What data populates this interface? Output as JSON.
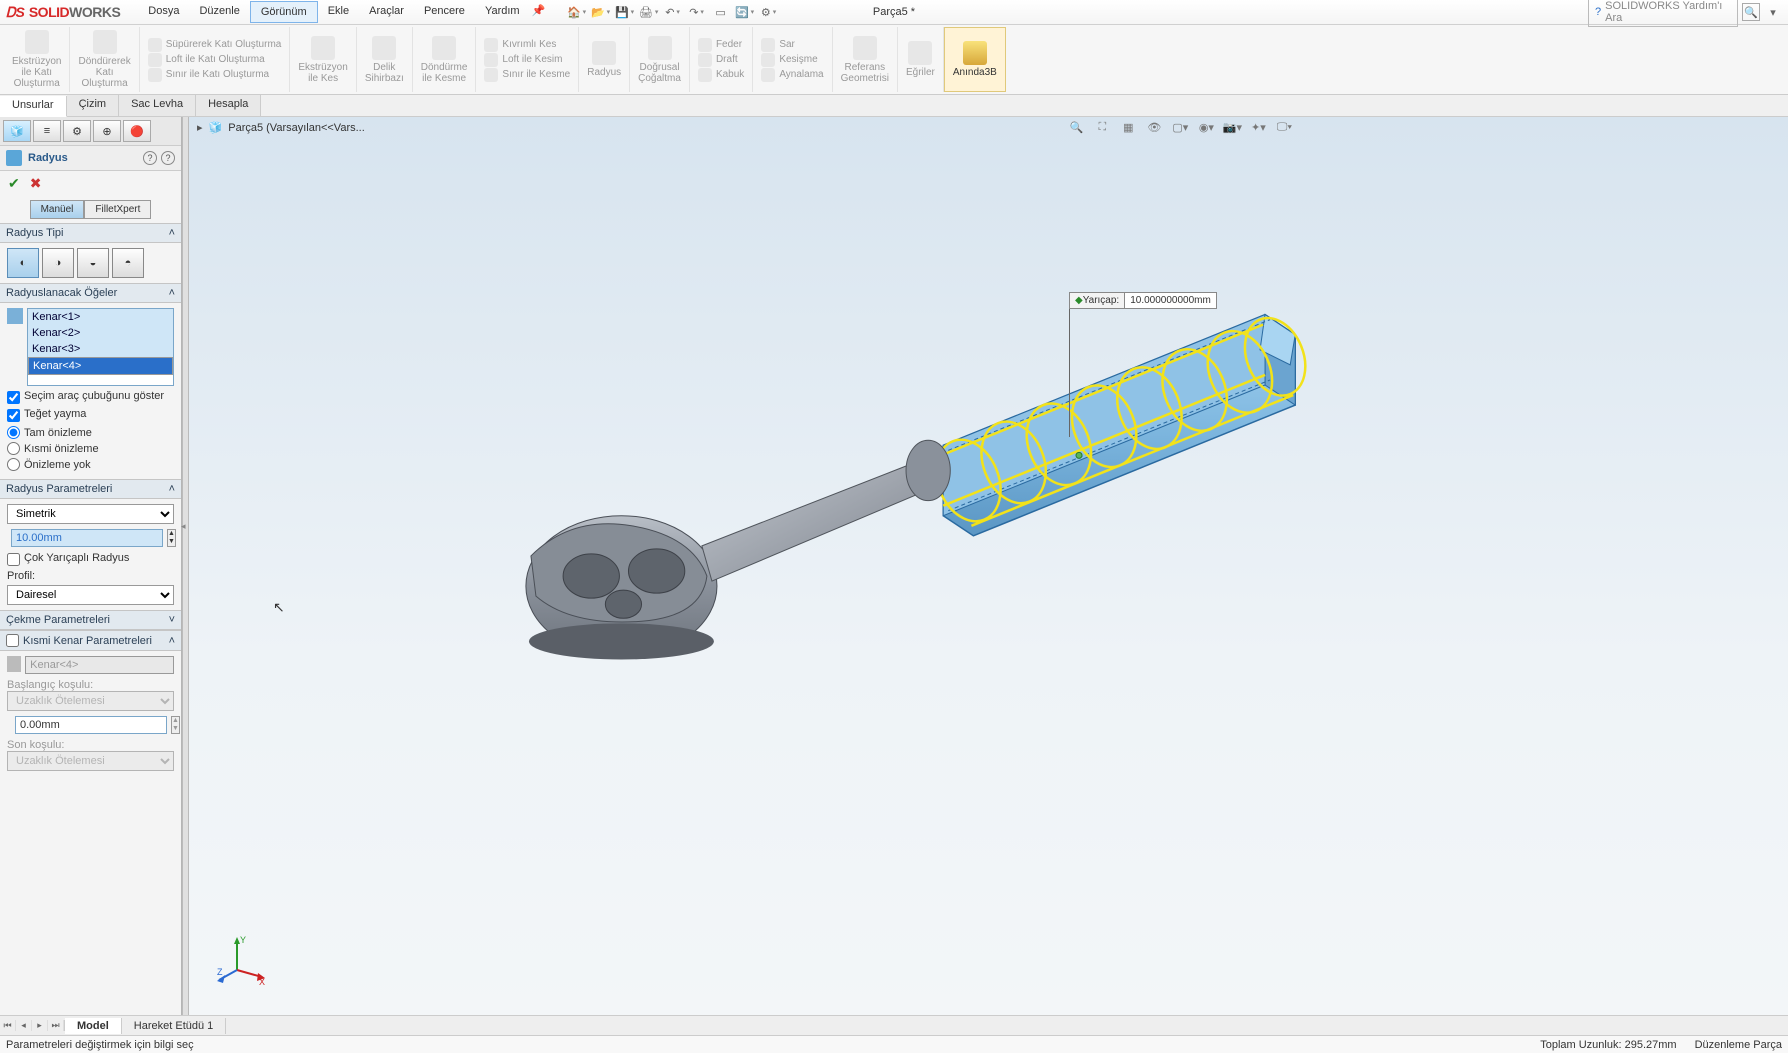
{
  "app": {
    "name_solid": "SOLID",
    "name_works": "WORKS",
    "ds": "DS"
  },
  "menus": [
    "Dosya",
    "Düzenle",
    "Görünüm",
    "Ekle",
    "Araçlar",
    "Pencere",
    "Yardım"
  ],
  "menu_active_index": 2,
  "doc_title": "Parça5 *",
  "search_placeholder": "SOLIDWORKS Yardım'ı Ara",
  "ribbon": {
    "g1": {
      "l1": "Ekstrüzyon",
      "l2": "ile Katı",
      "l3": "Oluşturma"
    },
    "g2": {
      "l1": "Döndürerek",
      "l2": "Katı",
      "l3": "Oluşturma"
    },
    "g3a": "Süpürerek Katı Oluşturma",
    "g3b": "Loft ile Katı Oluşturma",
    "g3c": "Sınır ile Katı Oluşturma",
    "g4": {
      "l1": "Ekstrüzyon",
      "l2": "ile Kes"
    },
    "g5": {
      "l1": "Delik",
      "l2": "Sihirbazı"
    },
    "g6": {
      "l1": "Döndürme",
      "l2": "ile Kesme"
    },
    "g7a": "Kıvrımlı Kes",
    "g7b": "Loft ile Kesim",
    "g7c": "Sınır ile Kesme",
    "g8": "Radyus",
    "g9": {
      "l1": "Doğrusal",
      "l2": "Çoğaltma"
    },
    "g10a": "Feder",
    "g10b": "Draft",
    "g10c": "Kabuk",
    "g11a": "Sar",
    "g11b": "Kesişme",
    "g11c": "Aynalama",
    "g12": {
      "l1": "Referans",
      "l2": "Geometrisi"
    },
    "g13": "Eğriler",
    "g14": "Anında3B"
  },
  "ftabs": [
    "Unsurlar",
    "Çizim",
    "Sac Levha",
    "Hesapla"
  ],
  "ftab_active": 0,
  "crumb": "Parça5  (Varsayılan<<Vars...",
  "pm": {
    "title": "Radyus",
    "mode_tabs": [
      "Manüel",
      "FilletXpert"
    ],
    "mode_active": 0,
    "sec_type": "Radyus Tipi",
    "sec_items": "Radyuslanacak Öğeler",
    "edges": [
      "Kenar<1>",
      "Kenar<2>",
      "Kenar<3>",
      "Kenar<4>"
    ],
    "edge_sel_index": 3,
    "chk_toolbar": "Seçim araç çubuğunu göster",
    "chk_tangent": "Teğet yayma",
    "rad_full": "Tam önizleme",
    "rad_partial": "Kısmi önizleme",
    "rad_none": "Önizleme yok",
    "sec_params": "Radyus Parametreleri",
    "sym": "Simetrik",
    "radius_val": "10.00mm",
    "chk_multi": "Çok Yarıçaplı Radyus",
    "profile": "Profil:",
    "profile_val": "Dairesel",
    "sec_pull": "Çekme Parametreleri",
    "sec_partial": "Kısmi Kenar Parametreleri",
    "pk_edge": "Kenar<4>",
    "start_cond": "Başlangıç koşulu:",
    "offset1": "Uzaklık Ötelemesi",
    "offset_val": "0.00mm",
    "end_cond": "Son koşulu:",
    "offset2": "Uzaklık Ötelemesi"
  },
  "callout": {
    "label": "Yarıçap:",
    "value": "10.000000000mm"
  },
  "btabs": [
    "Model",
    "Hareket Etüdü 1"
  ],
  "status_msg": "Parametreleri değiştirmek için bilgi seç",
  "status_len": "Toplam Uzunluk: 295.27mm",
  "status_mode": "Düzenleme Parça",
  "triad": {
    "x": "X",
    "y": "Y",
    "z": "Z"
  }
}
